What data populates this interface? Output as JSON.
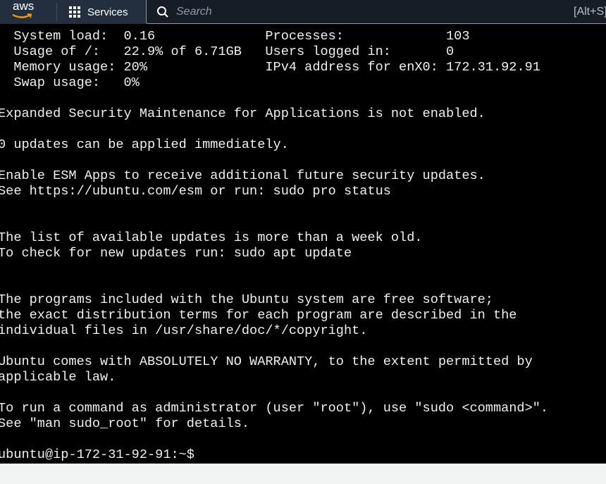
{
  "topbar": {
    "logo_text": "aws",
    "services_label": "Services",
    "search_placeholder": "Search",
    "search_shortcut": "[Alt+S]",
    "colors": {
      "bar": "#232f3e",
      "logo_smile": "#ff9900"
    }
  },
  "terminal": {
    "lines": [
      "  System load:  0.16              Processes:             103",
      "  Usage of /:   22.9% of 6.71GB   Users logged in:       0",
      "  Memory usage: 20%               IPv4 address for enX0: 172.31.92.91",
      "  Swap usage:   0%",
      "",
      "Expanded Security Maintenance for Applications is not enabled.",
      "",
      "0 updates can be applied immediately.",
      "",
      "Enable ESM Apps to receive additional future security updates.",
      "See https://ubuntu.com/esm or run: sudo pro status",
      "",
      "",
      "The list of available updates is more than a week old.",
      "To check for new updates run: sudo apt update",
      "",
      "",
      "The programs included with the Ubuntu system are free software;",
      "the exact distribution terms for each program are described in the",
      "individual files in /usr/share/doc/*/copyright.",
      "",
      "Ubuntu comes with ABSOLUTELY NO WARRANTY, to the extent permitted by",
      "applicable law.",
      "",
      "To run a command as administrator (user \"root\"), use \"sudo <command>\".",
      "See \"man sudo_root\" for details.",
      "",
      "ubuntu@ip-172-31-92-91:~$"
    ]
  }
}
